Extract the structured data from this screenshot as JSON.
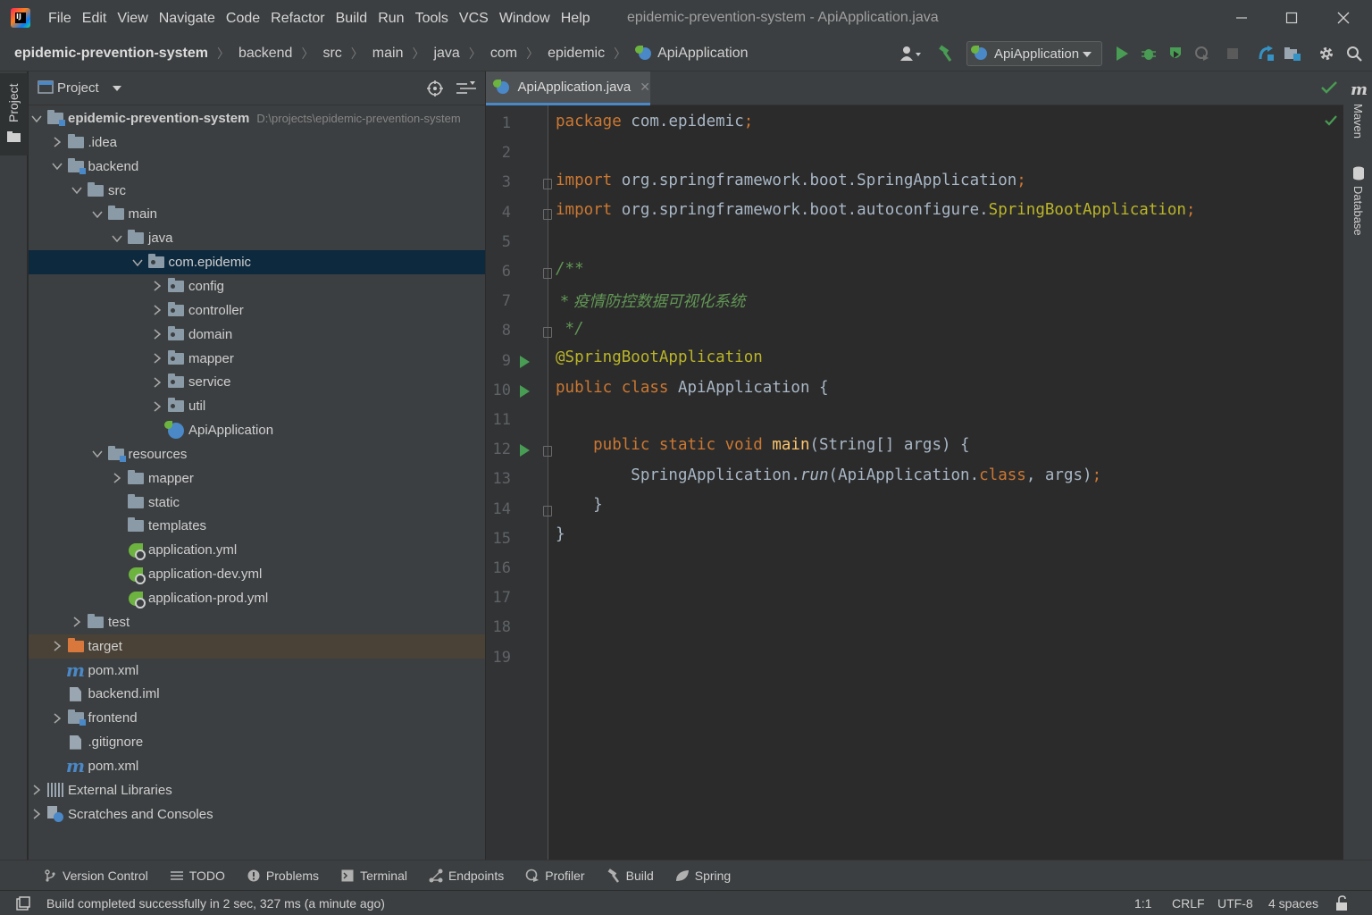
{
  "window": {
    "title": "epidemic-prevention-system - ApiApplication.java",
    "logo_text": "IJ",
    "menu": [
      "File",
      "Edit",
      "View",
      "Navigate",
      "Code",
      "Refactor",
      "Build",
      "Run",
      "Tools",
      "VCS",
      "Window",
      "Help"
    ]
  },
  "breadcrumb": [
    "epidemic-prevention-system",
    "backend",
    "src",
    "main",
    "java",
    "com",
    "epidemic",
    "ApiApplication"
  ],
  "toolbar": {
    "run_config": "ApiApplication"
  },
  "left_strip": {
    "project_tab": "Project"
  },
  "project_panel": {
    "title": "Project",
    "tree": [
      {
        "label": "epidemic-prevention-system",
        "path": "D:\\projects\\epidemic-prevention-system",
        "icon": "module-folder",
        "depth": 0,
        "expanded": true
      },
      {
        "label": ".idea",
        "icon": "folder",
        "depth": 1,
        "expanded": false
      },
      {
        "label": "backend",
        "icon": "module-folder",
        "depth": 1,
        "expanded": true
      },
      {
        "label": "src",
        "icon": "folder",
        "depth": 2,
        "expanded": true
      },
      {
        "label": "main",
        "icon": "folder",
        "depth": 3,
        "expanded": true
      },
      {
        "label": "java",
        "icon": "source-folder",
        "depth": 4,
        "expanded": true
      },
      {
        "label": "com.epidemic",
        "icon": "package",
        "depth": 5,
        "expanded": true,
        "selected": true
      },
      {
        "label": "config",
        "icon": "package",
        "depth": 6,
        "expanded": false
      },
      {
        "label": "controller",
        "icon": "package",
        "depth": 6,
        "expanded": false
      },
      {
        "label": "domain",
        "icon": "package",
        "depth": 6,
        "expanded": false
      },
      {
        "label": "mapper",
        "icon": "package",
        "depth": 6,
        "expanded": false
      },
      {
        "label": "service",
        "icon": "package",
        "depth": 6,
        "expanded": false
      },
      {
        "label": "util",
        "icon": "package",
        "depth": 6,
        "expanded": false
      },
      {
        "label": "ApiApplication",
        "icon": "spring-class",
        "depth": 6
      },
      {
        "label": "resources",
        "icon": "resources-folder",
        "depth": 3,
        "expanded": true
      },
      {
        "label": "mapper",
        "icon": "folder",
        "depth": 4,
        "expanded": false
      },
      {
        "label": "static",
        "icon": "folder",
        "depth": 4
      },
      {
        "label": "templates",
        "icon": "folder",
        "depth": 4
      },
      {
        "label": "application.yml",
        "icon": "spring-yml",
        "depth": 4
      },
      {
        "label": "application-dev.yml",
        "icon": "spring-yml",
        "depth": 4
      },
      {
        "label": "application-prod.yml",
        "icon": "spring-yml",
        "depth": 4
      },
      {
        "label": "test",
        "icon": "folder",
        "depth": 2,
        "expanded": false
      },
      {
        "label": "target",
        "icon": "excluded-folder",
        "depth": 1,
        "expanded": false,
        "excluded": true
      },
      {
        "label": "pom.xml",
        "icon": "maven",
        "depth": 1
      },
      {
        "label": "backend.iml",
        "icon": "file",
        "depth": 1
      },
      {
        "label": "frontend",
        "icon": "module-folder",
        "depth": 1,
        "expanded": false
      },
      {
        "label": ".gitignore",
        "icon": "file",
        "depth": 1
      },
      {
        "label": "pom.xml",
        "icon": "maven",
        "depth": 1
      },
      {
        "label": "External Libraries",
        "icon": "libraries",
        "depth": 0,
        "expanded": false
      },
      {
        "label": "Scratches and Consoles",
        "icon": "scratches",
        "depth": 0,
        "expanded": false
      }
    ]
  },
  "editor": {
    "tab": "ApiApplication.java",
    "line_numbers": [
      "1",
      "2",
      "3",
      "4",
      "5",
      "6",
      "7",
      "8",
      "9",
      "10",
      "11",
      "12",
      "13",
      "14",
      "15",
      "16",
      "17",
      "18",
      "19"
    ],
    "code": {
      "l1_kw": "package",
      "l1_rest": " com.epidemic",
      "l1_semi": ";",
      "l3_kw": "import",
      "l3_rest": " org.springframework.boot.SpringApplication",
      "l3_semi": ";",
      "l4_kw": "import",
      "l4_rest": " org.springframework.boot.autoconfigure.",
      "l4_ann": "SpringBootApplication",
      "l4_semi": ";",
      "l6": "/**",
      "l7": " * 疫情防控数据可视化系统",
      "l8": " */",
      "l9": "@SpringBootApplication",
      "l10_kw": "public class",
      "l10_rest": " ApiApplication {",
      "l12_kw": "    public static void",
      "l12_fn": " main",
      "l12_rest": "(String[] args) {",
      "l13_a": "        SpringApplication.",
      "l13_run": "run",
      "l13_b": "(ApiApplication.",
      "l13_kw": "class",
      "l13_c": ", args)",
      "l13_semi": ";",
      "l14": "    }",
      "l15": "}"
    }
  },
  "right_strip": {
    "maven": "Maven",
    "database": "Database"
  },
  "bottom_tabs": [
    {
      "label": "Version Control",
      "icon": "branch-icon"
    },
    {
      "label": "TODO",
      "icon": "list-icon"
    },
    {
      "label": "Problems",
      "icon": "warning-icon"
    },
    {
      "label": "Terminal",
      "icon": "terminal-icon"
    },
    {
      "label": "Endpoints",
      "icon": "endpoints-icon"
    },
    {
      "label": "Profiler",
      "icon": "profiler-icon"
    },
    {
      "label": "Build",
      "icon": "hammer-icon"
    },
    {
      "label": "Spring",
      "icon": "spring-icon"
    }
  ],
  "status": {
    "message": "Build completed successfully in 2 sec, 327 ms (a minute ago)",
    "position": "1:1",
    "line_sep": "CRLF",
    "encoding": "UTF-8",
    "indent": "4 spaces"
  },
  "colors": {
    "background": "#2b2b2b",
    "panel": "#3c3f41",
    "selection": "#0d293e",
    "keyword": "#cc7832",
    "annotation": "#bbb529",
    "comment": "#629755",
    "method": "#ffc66d",
    "run_green": "#499c54"
  }
}
